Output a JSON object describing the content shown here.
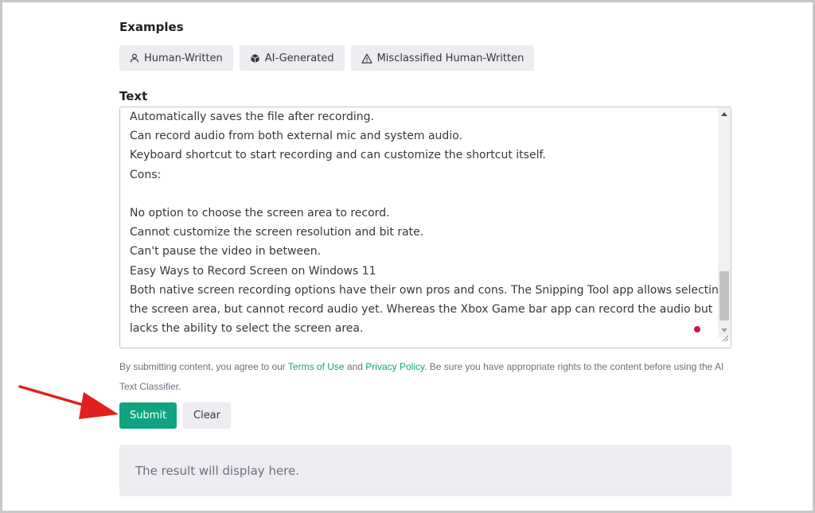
{
  "examples": {
    "label": "Examples",
    "items": [
      {
        "label": "Human-Written",
        "icon": "user-icon"
      },
      {
        "label": "AI-Generated",
        "icon": "cube-icon"
      },
      {
        "label": "Misclassified Human-Written",
        "icon": "warning-triangle-icon"
      }
    ]
  },
  "text": {
    "label": "Text",
    "lines": [
      "Automatically saves the file after recording.",
      "Can record audio from both external mic and system audio.",
      "Keyboard shortcut to start recording and can customize the shortcut itself.",
      "Cons:",
      "",
      "No option to choose the screen area to record.",
      "Cannot customize the screen resolution and bit rate.",
      "Can't pause the video in between.",
      "Easy Ways to Record Screen on Windows 11",
      "Both native screen recording options have their own pros and cons. The Snipping Tool app allows selecting",
      "the screen area, but cannot record audio yet. Whereas the Xbox Game bar app can record the audio but",
      "lacks the ability to select the screen area."
    ]
  },
  "disclaimer": {
    "prefix": "By submitting content, you agree to our ",
    "terms_link": "Terms of Use",
    "middle": " and ",
    "privacy_link": "Privacy Policy",
    "suffix": ". Be sure you have appropriate rights to the content before using the AI Text Classifier."
  },
  "buttons": {
    "submit": "Submit",
    "clear": "Clear"
  },
  "result": {
    "placeholder": "The result will display here."
  },
  "colors": {
    "accent": "#10a37f",
    "annotation_arrow": "#e0201d"
  }
}
